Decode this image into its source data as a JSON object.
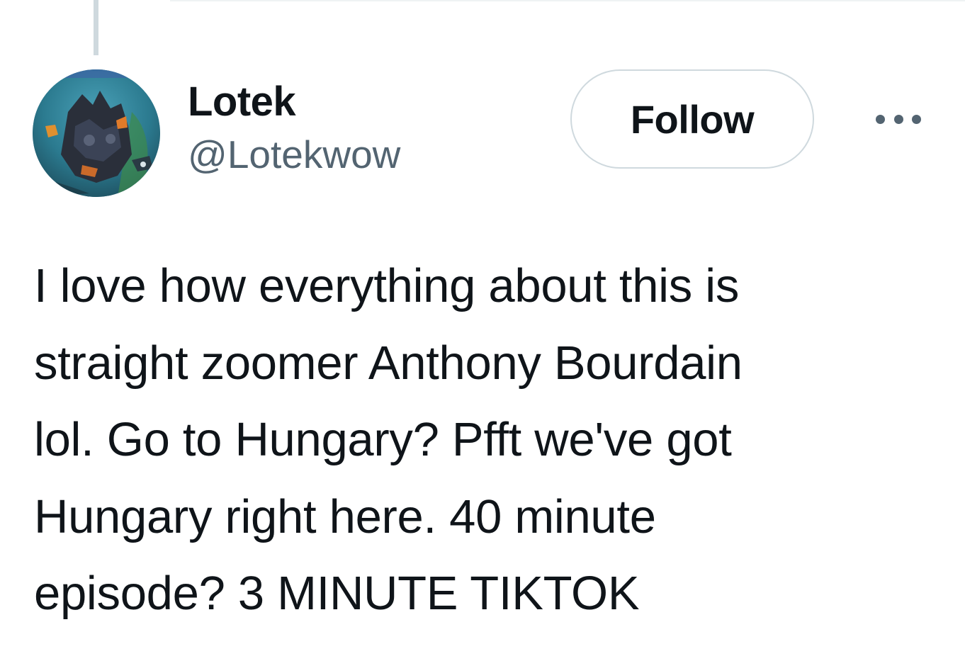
{
  "tweet": {
    "author": {
      "display_name": "Lotek",
      "handle": "@Lotekwow",
      "avatar_icon": "game-character-avatar"
    },
    "follow_label": "Follow",
    "more_icon": "more-dots-icon",
    "text_lines": [
      "I love how everything about this is",
      "straight zoomer Anthony Bourdain",
      "lol. Go to Hungary? Pfft we've got",
      "Hungary right here. 40 minute",
      "episode? 3 MINUTE TIKTOK"
    ]
  },
  "colors": {
    "text_primary": "#0f1419",
    "text_secondary": "#536471",
    "border": "#cfd9de"
  }
}
